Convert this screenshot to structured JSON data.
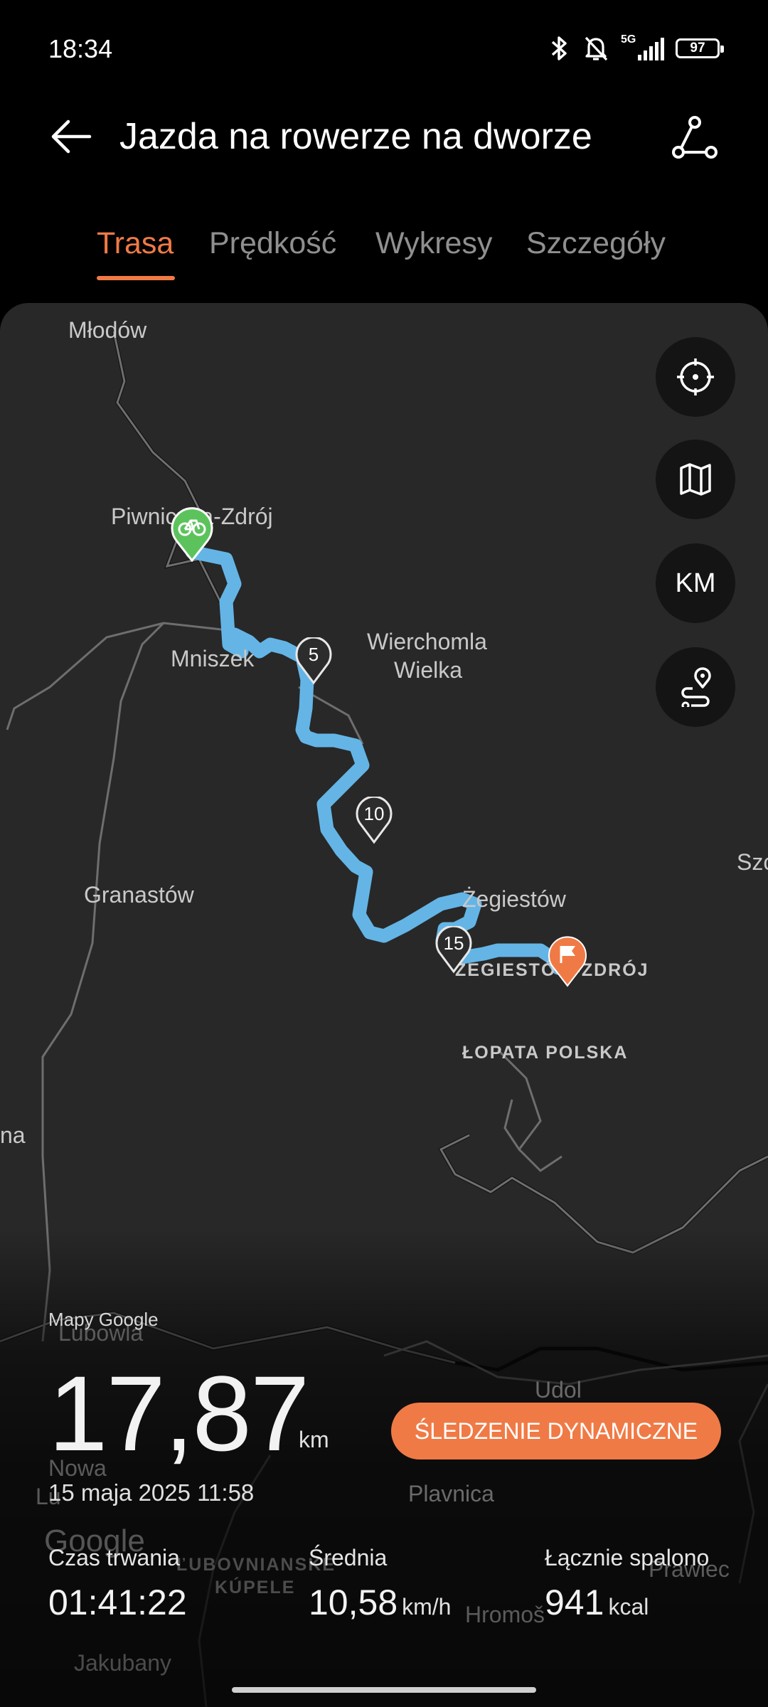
{
  "status_bar": {
    "time": "18:34",
    "network": "5G",
    "battery": "97"
  },
  "header": {
    "title": "Jazda na rowerze na dworze"
  },
  "tabs": [
    {
      "label": "Trasa",
      "active": true
    },
    {
      "label": "Prędkość",
      "active": false
    },
    {
      "label": "Wykresy",
      "active": false
    },
    {
      "label": "Szczegóły",
      "active": false
    }
  ],
  "map": {
    "labels": {
      "mlodow": "Młodów",
      "piwniczna": "Piwniczna-Zdrój",
      "mniszek": "Mniszek",
      "wierchomla1": "Wierchomla",
      "wierchomla2": "Wielka",
      "granastow": "Granastów",
      "zegiestow": "Żegiestów",
      "zegiestow_zdroj": "ŻEGIESTÓW-ZDRÓJ",
      "lopata": "ŁOPATA POLSKA",
      "szc": "Szc",
      "na": "na",
      "lubowla": "Lubowla",
      "udol": "Udol",
      "nowa": "Nowa",
      "lu": "Lu",
      "plavnica": "Plavnica",
      "google": "Google",
      "kupele1": "ĽUBOVNIANSKE",
      "kupele2": "KÚPELE",
      "prawiec": "Prawiec",
      "hromos": "Hromoš",
      "jakubany": "Jakubany"
    },
    "km_markers": [
      "5",
      "10",
      "15"
    ],
    "controls": {
      "units_label": "KM"
    },
    "route_color": "#64b5e6",
    "start_color": "#5cc35c",
    "finish_color": "#f07a45"
  },
  "stats": {
    "attribution": "Mapy Google",
    "distance": "17,87",
    "distance_unit": "km",
    "live_button": "ŚLEDZENIE DYNAMICZNE",
    "date": "15 maja 2025 11:58",
    "duration_label": "Czas trwania",
    "duration_value": "01:41:22",
    "avg_label": "Średnia",
    "avg_value": "10,58",
    "avg_unit": "km/h",
    "calories_label": "Łącznie spalono",
    "calories_value": "941",
    "calories_unit": "kcal"
  }
}
